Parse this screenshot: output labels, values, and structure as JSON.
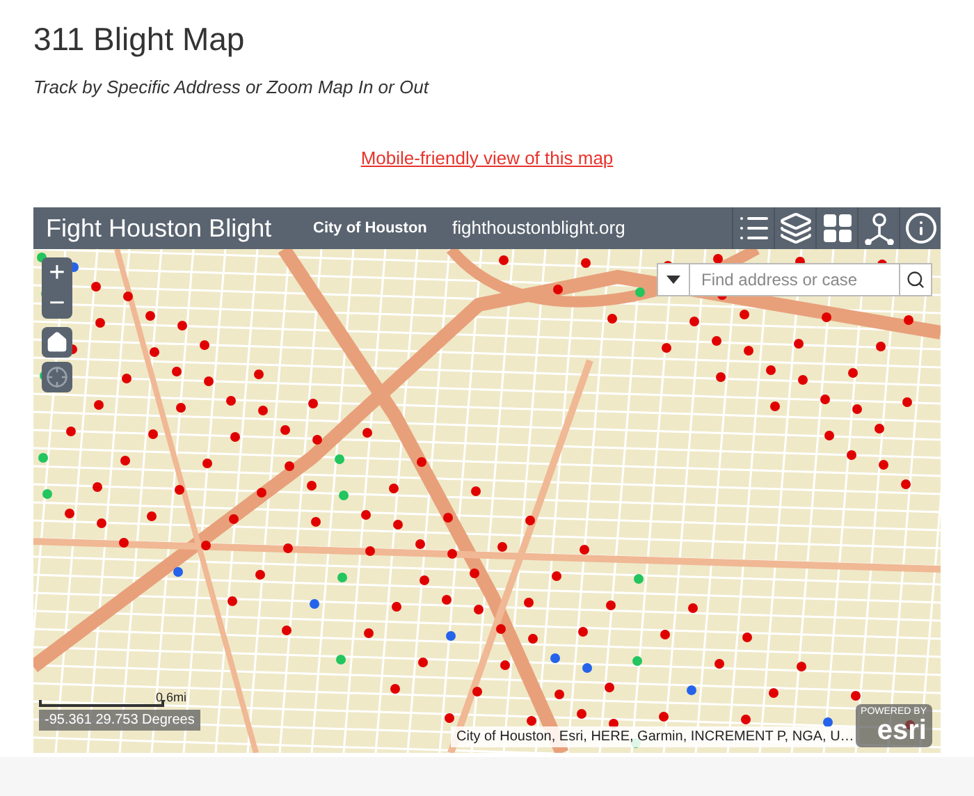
{
  "page": {
    "title": "311 Blight Map",
    "subtitle": "Track by Specific Address or Zoom Map In or Out",
    "link": "Mobile-friendly view of this map"
  },
  "map_app": {
    "title": "Fight Houston Blight",
    "organization": "City of Houston",
    "website": "fighthoustonblight.org",
    "search": {
      "placeholder": "Find address or case"
    },
    "zoom_in": "+",
    "zoom_out": "−",
    "scale": "0.6mi",
    "coordinates": "-95.361 29.753 Degrees",
    "attribution": "City of Houston, Esri, HERE, Garmin, INCREMENT P, NGA, U…",
    "logo": {
      "tagline": "POWERED BY",
      "name": "esri"
    }
  }
}
